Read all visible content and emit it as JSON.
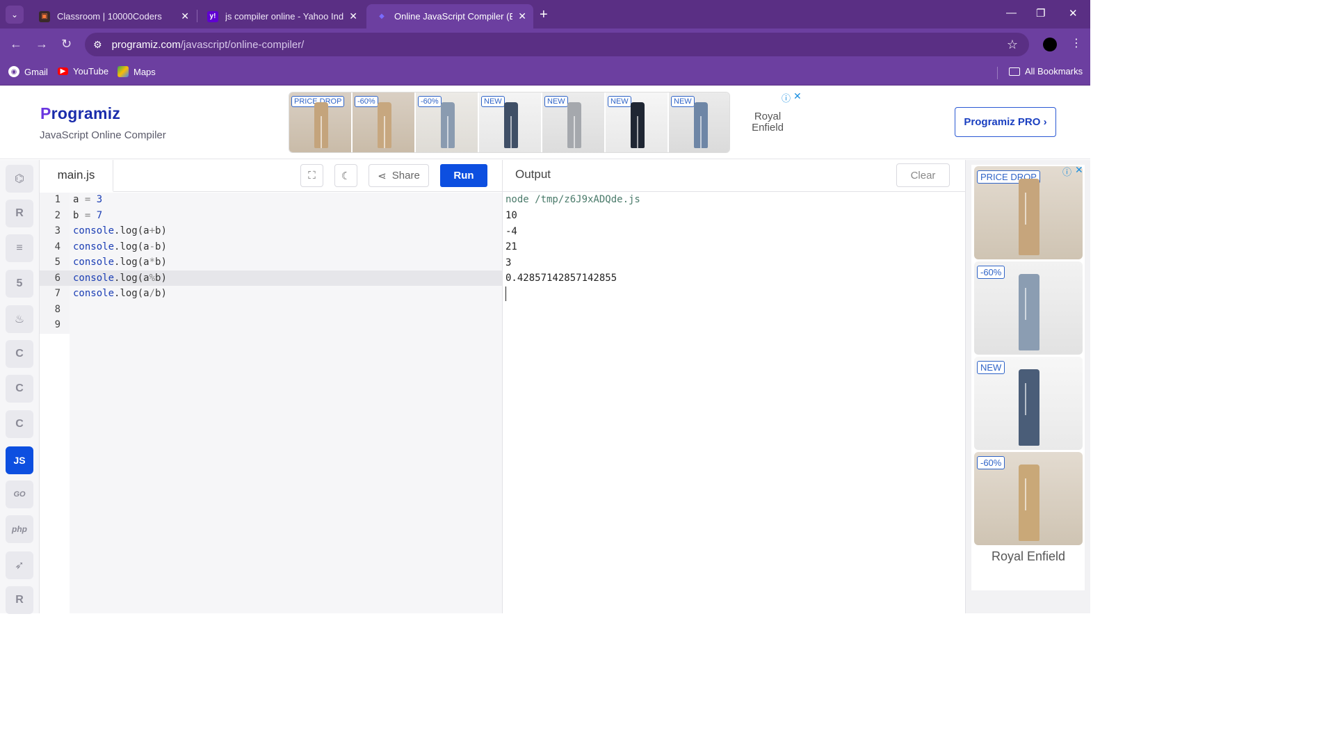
{
  "browser": {
    "tabs": [
      {
        "title": "Classroom | 10000Coders",
        "favicon": "classroom-favicon"
      },
      {
        "title": "js compiler online - Yahoo India",
        "favicon": "yahoo-favicon"
      },
      {
        "title": "Online JavaScript Compiler (Edit",
        "favicon": "programiz-favicon"
      }
    ],
    "url_host": "programiz.com",
    "url_path": "/javascript/online-compiler/",
    "bookmarks": [
      {
        "label": "Gmail",
        "icon": "gmail-icon"
      },
      {
        "label": "YouTube",
        "icon": "youtube-icon"
      },
      {
        "label": "Maps",
        "icon": "maps-icon"
      }
    ],
    "all_bookmarks": "All Bookmarks",
    "colors": {
      "frame": "#5a2f84",
      "toolbar": "#6c3fa0"
    }
  },
  "site": {
    "logo": "rogramiz",
    "logo_p": "P",
    "subtitle": "JavaScript Online Compiler",
    "pro_button": "Programiz PRO ›",
    "accent": "#0d4fe0"
  },
  "top_ad": {
    "badges": [
      "PRICE DROP",
      "-60%",
      "-60%",
      "NEW",
      "NEW",
      "NEW",
      "NEW"
    ],
    "brand_line1": "Royal",
    "brand_line2": "Enfield"
  },
  "languages": [
    {
      "name": "python-icon",
      "glyph": "⌬"
    },
    {
      "name": "r-icon",
      "glyph": "R"
    },
    {
      "name": "sql-icon",
      "glyph": "≡"
    },
    {
      "name": "html-icon",
      "glyph": "5"
    },
    {
      "name": "java-icon",
      "glyph": "♨"
    },
    {
      "name": "c-icon",
      "glyph": "C"
    },
    {
      "name": "cpp-icon",
      "glyph": "C"
    },
    {
      "name": "csharp-icon",
      "glyph": "C"
    },
    {
      "name": "js-icon",
      "glyph": "JS"
    },
    {
      "name": "go-icon",
      "glyph": "GO"
    },
    {
      "name": "php-icon",
      "glyph": "php"
    },
    {
      "name": "swift-icon",
      "glyph": "➶"
    },
    {
      "name": "rust-icon",
      "glyph": "R"
    }
  ],
  "editor": {
    "filename": "main.js",
    "share_label": "Share",
    "run_label": "Run",
    "line_numbers": [
      "1",
      "2",
      "3",
      "4",
      "5",
      "6",
      "7",
      "8",
      "9"
    ],
    "lines": [
      [
        "a",
        " = ",
        "3"
      ],
      [
        "b",
        " = ",
        "7"
      ],
      [
        "console",
        ".log(a",
        "+",
        "b)"
      ],
      [
        "console",
        ".log(a",
        "-",
        "b)"
      ],
      [
        "console",
        ".log(a",
        "*",
        "b)"
      ],
      [
        "console",
        ".log(a",
        "%",
        "b)"
      ],
      [
        "console",
        ".log(a",
        "/",
        "b)"
      ]
    ]
  },
  "output": {
    "title": "Output",
    "clear_label": "Clear",
    "command": "node /tmp/z6J9xADQde.js",
    "lines": [
      "10",
      "-4",
      "21",
      "3",
      "0.42857142857142855"
    ]
  },
  "side_ad": {
    "badges": [
      "PRICE DROP",
      "-60%",
      "NEW",
      "-60%"
    ],
    "brand": "Royal Enfield"
  }
}
